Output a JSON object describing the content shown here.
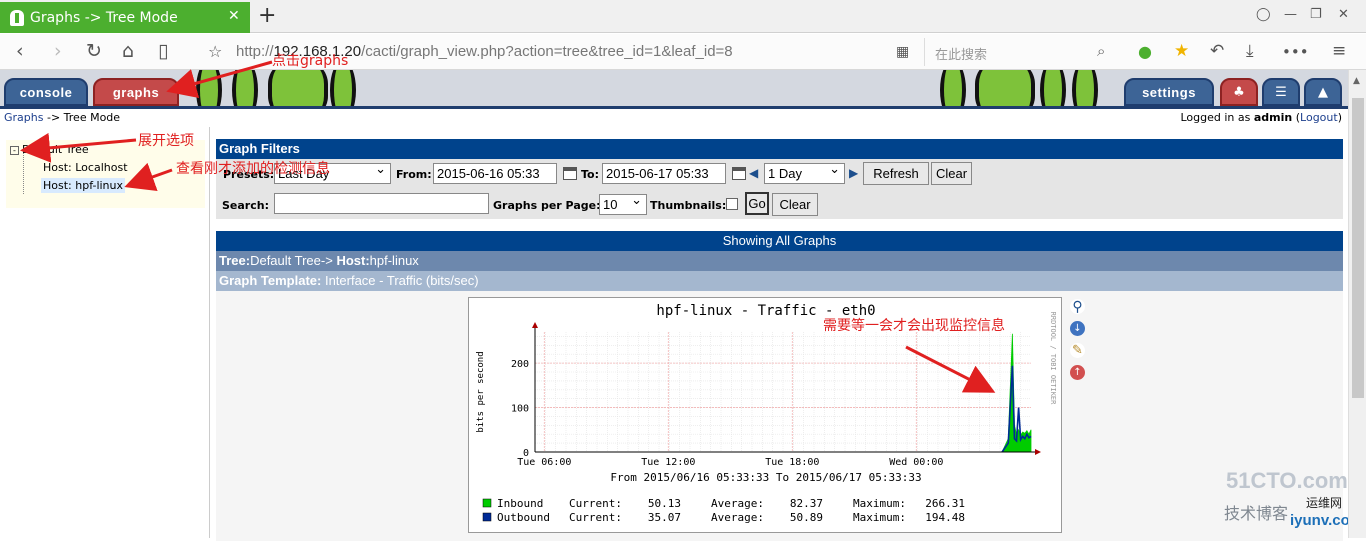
{
  "browser": {
    "tab_title": "Graphs -> Tree Mode",
    "tab_close": "✕",
    "new_tab": "+",
    "url_prefix": "http://",
    "url_host": "192.168.1.20",
    "url_path": "/cacti/graph_view.php?action=tree&tree_id=1&leaf_id=8",
    "search_placeholder": "在此搜索"
  },
  "cacti": {
    "tabs": {
      "console": "console",
      "graphs": "graphs",
      "settings": "settings"
    },
    "breadcrumb": {
      "link": "Graphs",
      "rest": " -> Tree Mode"
    },
    "logged": {
      "prefix": "Logged in as ",
      "user": "admin",
      "open": " (",
      "logout": "Logout",
      "close": ")"
    }
  },
  "tree": {
    "root": "Default Tree",
    "root_toggle": "-",
    "hosts": [
      "Host: Localhost",
      "Host: hpf-linux"
    ]
  },
  "filters": {
    "title": "Graph Filters",
    "presets_label": "Presets:",
    "presets_value": "Last Day",
    "from_label": "From:",
    "from_value": "2015-06-16 05:33",
    "to_label": "To:",
    "to_value": "2015-06-17 05:33",
    "span_value": "1 Day",
    "refresh": "Refresh",
    "clear": "Clear",
    "search_label": "Search:",
    "search_value": "",
    "gpp_label": "Graphs per Page:",
    "gpp_value": "10",
    "thumbs_label": "Thumbnails:",
    "go": "Go",
    "clear2": "Clear"
  },
  "listing": {
    "showing": "Showing All Graphs",
    "tree_label": "Tree:",
    "tree_value": "Default Tree-> ",
    "host_label": "Host:",
    "host_value": "hpf-linux",
    "template_label": "Graph Template:",
    "template_value": " Interface - Traffic (bits/sec)"
  },
  "chart_data": {
    "type": "area",
    "title": "hpf-linux - Traffic - eth0",
    "ylabel": "bits per second",
    "side_label": "RRDTOOL / TOBI OETIKER",
    "x_ticks": [
      "Tue 06:00",
      "Tue 12:00",
      "Tue 18:00",
      "Wed 00:00"
    ],
    "x_range_label": "From 2015/06/16 05:33:33 To 2015/06/17 05:33:33",
    "y_ticks": [
      0,
      100,
      200
    ],
    "ylim": [
      0,
      270
    ],
    "x_hours": [
      22.6,
      22.9,
      23.1,
      23.2,
      23.3,
      23.4,
      23.5,
      23.6,
      23.7,
      23.8,
      23.9,
      24.0
    ],
    "series": [
      {
        "name": "Inbound",
        "color": "#00cc00",
        "values": [
          0,
          30,
          266,
          60,
          40,
          50,
          38,
          45,
          42,
          48,
          40,
          50
        ]
      },
      {
        "name": "Outbound",
        "color": "#002a97",
        "values": [
          0,
          20,
          194,
          30,
          25,
          100,
          28,
          35,
          30,
          40,
          32,
          35
        ]
      }
    ],
    "legend": [
      {
        "name": "Inbound",
        "color": "#00cc00",
        "current": "50.13",
        "average": "82.37",
        "maximum": "266.31"
      },
      {
        "name": "Outbound",
        "color": "#002a97",
        "current": "35.07",
        "average": "50.89",
        "maximum": "194.48"
      }
    ],
    "legend_labels": {
      "current": "Current:",
      "average": "Average:",
      "maximum": "Maximum:"
    }
  },
  "annotations": {
    "click_graphs": "点击graphs",
    "expand": "展开选项",
    "view_host": "查看刚才添加的检测信息",
    "wait": "需要等一会才会出现监控信息"
  },
  "watermark": {
    "brand": "51CTO.com",
    "sub": "技术博客",
    "site": "运维网",
    "url": "iyunv.com"
  }
}
